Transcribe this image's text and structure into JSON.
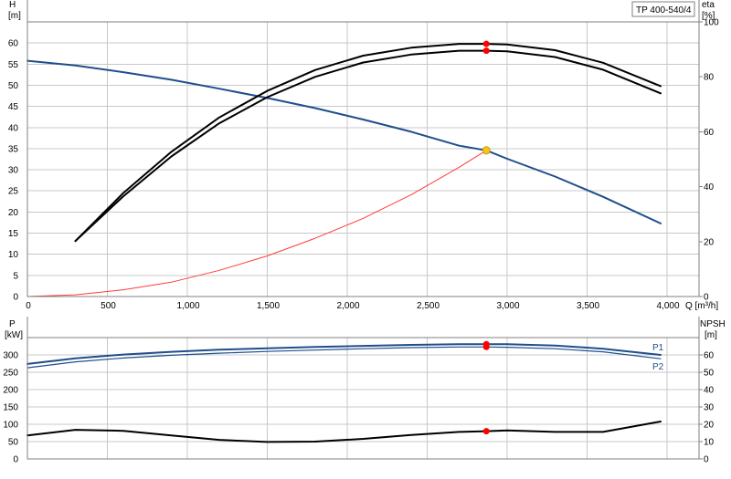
{
  "chart_data": {
    "type": "line",
    "model_label": "TP 400-540/4",
    "top": {
      "left_axis": {
        "label_top": "H",
        "label_unit": "[m]",
        "ticks": [
          0,
          5,
          10,
          15,
          20,
          25,
          30,
          35,
          40,
          45,
          50,
          55,
          60
        ],
        "ylim": [
          0,
          65
        ]
      },
      "right_axis": {
        "label_top": "eta",
        "label_unit": "[%]",
        "ticks": [
          0,
          20,
          40,
          60,
          80,
          100
        ],
        "ylim": [
          0,
          100
        ]
      },
      "x_axis": {
        "ticks": [
          0,
          500,
          1000,
          1500,
          2000,
          2500,
          3000,
          3500,
          4000
        ],
        "tick_labels": [
          "0",
          "500",
          "1,000",
          "1,500",
          "2,000",
          "2,500",
          "3,000",
          "3,500",
          "4,000"
        ],
        "label": "Q [m³/h]",
        "xlim": [
          0,
          4200
        ]
      },
      "series": [
        {
          "key": "H",
          "axis": "left",
          "color": "#1f4e8c",
          "width": 2,
          "x": [
            0,
            300,
            600,
            900,
            1200,
            1500,
            1800,
            2100,
            2400,
            2700,
            2870,
            3000,
            3300,
            3600,
            3960
          ],
          "y": [
            55.8,
            54.7,
            53.1,
            51.3,
            49.2,
            47.0,
            44.6,
            41.9,
            39.0,
            35.7,
            34.6,
            32.6,
            28.4,
            23.6,
            17.3
          ]
        },
        {
          "key": "eta_upper",
          "axis": "right",
          "color": "#000000",
          "width": 2,
          "x": [
            300,
            600,
            900,
            1200,
            1500,
            1800,
            2100,
            2400,
            2700,
            2870,
            3000,
            3300,
            3600,
            3960
          ],
          "y": [
            20.2,
            37.7,
            52.7,
            65.2,
            74.9,
            82.5,
            87.7,
            90.6,
            92.0,
            92.0,
            91.8,
            89.7,
            85.1,
            76.6
          ]
        },
        {
          "key": "eta_lower",
          "axis": "right",
          "color": "#000000",
          "width": 2,
          "x": [
            300,
            600,
            900,
            1200,
            1500,
            1800,
            2100,
            2400,
            2700,
            2870,
            3000,
            3300,
            3600,
            3960
          ],
          "y": [
            20.2,
            36.5,
            51.0,
            63.1,
            72.6,
            80.0,
            85.2,
            88.1,
            89.5,
            89.5,
            89.3,
            87.2,
            82.6,
            74.0
          ]
        },
        {
          "key": "system",
          "axis": "left",
          "color": "#ff3b3b",
          "width": 1,
          "x": [
            0,
            300,
            600,
            900,
            1200,
            1500,
            1800,
            2100,
            2400,
            2700,
            2870
          ],
          "y": [
            0,
            0.4,
            1.6,
            3.4,
            6.2,
            9.6,
            13.8,
            18.5,
            24.1,
            30.6,
            34.6
          ]
        }
      ],
      "points": [
        {
          "key": "duty-point",
          "axis": "left",
          "x": 2870,
          "y": 34.6,
          "color": "#f5c518",
          "stroke": "#c89b00",
          "r": 4
        },
        {
          "key": "eta-upper-point",
          "axis": "right",
          "x": 2870,
          "y": 92.0,
          "color": "#ff0000",
          "stroke": "#ff0000",
          "r": 3
        },
        {
          "key": "eta-lower-point",
          "axis": "right",
          "x": 2870,
          "y": 89.5,
          "color": "#ff0000",
          "stroke": "#ff0000",
          "r": 3
        }
      ]
    },
    "bottom": {
      "left_axis": {
        "label_top": "P",
        "label_unit": "[kW]",
        "ticks": [
          0,
          50,
          100,
          150,
          200,
          250,
          300
        ],
        "ylim": [
          0,
          350
        ]
      },
      "right_axis": {
        "label_top": "NPSH",
        "label_unit": "[m]",
        "ticks": [
          0,
          10,
          20,
          30,
          40,
          50,
          60
        ],
        "ylim": [
          0,
          70
        ]
      },
      "series": [
        {
          "key": "P1",
          "name": "P1",
          "axis": "left",
          "color": "#1f4e8c",
          "width": 2,
          "x": [
            0,
            300,
            600,
            900,
            1200,
            1500,
            1800,
            2100,
            2400,
            2700,
            2870,
            3000,
            3300,
            3600,
            3960
          ],
          "y": [
            274,
            290,
            301,
            309,
            315,
            319,
            323,
            326,
            329,
            331,
            331,
            331,
            327,
            318,
            300
          ]
        },
        {
          "key": "P2",
          "name": "P2",
          "axis": "left",
          "color": "#1f4e8c",
          "width": 1.2,
          "x": [
            0,
            300,
            600,
            900,
            1200,
            1500,
            1800,
            2100,
            2400,
            2700,
            2870,
            3000,
            3300,
            3600,
            3960
          ],
          "y": [
            263,
            280,
            291,
            299,
            305,
            310,
            314,
            318,
            321,
            323,
            323,
            322,
            318,
            309,
            289
          ]
        },
        {
          "key": "NPSH",
          "axis": "right",
          "color": "#000000",
          "width": 2,
          "x": [
            0,
            300,
            600,
            900,
            1200,
            1500,
            1800,
            2100,
            2400,
            2700,
            2870,
            3000,
            3300,
            3600,
            3960
          ],
          "y": [
            13.6,
            16.8,
            16.2,
            13.6,
            11.0,
            9.8,
            10.0,
            11.6,
            13.8,
            15.6,
            16.0,
            16.4,
            15.6,
            15.6,
            21.6
          ]
        }
      ],
      "points": [
        {
          "key": "p1-point",
          "axis": "left",
          "x": 2870,
          "y": 331,
          "color": "#ff0000",
          "stroke": "#ff0000",
          "r": 3
        },
        {
          "key": "p2-point",
          "axis": "left",
          "x": 2870,
          "y": 323,
          "color": "#ff0000",
          "stroke": "#ff0000",
          "r": 3
        },
        {
          "key": "npsh-point",
          "axis": "right",
          "x": 2870,
          "y": 16.0,
          "color": "#ff0000",
          "stroke": "#ff0000",
          "r": 3
        }
      ]
    },
    "grid": true
  }
}
